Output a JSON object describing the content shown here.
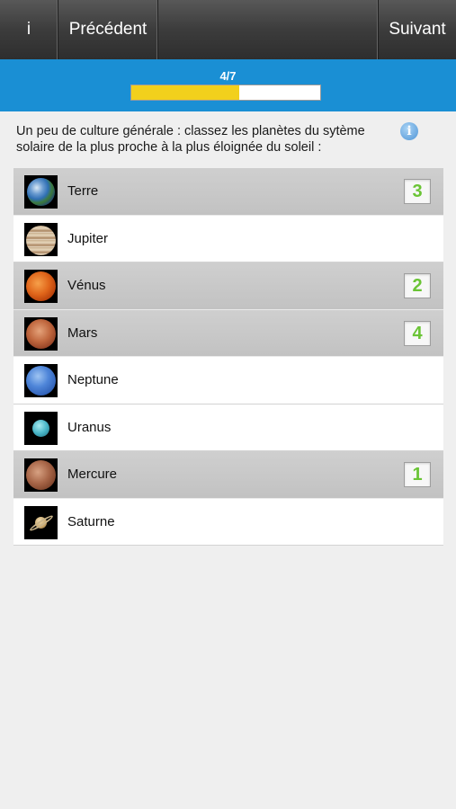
{
  "toolbar": {
    "info_label": "i",
    "prev_label": "Précédent",
    "next_label": "Suivant"
  },
  "progress": {
    "text": "4/7",
    "fraction": 0.57
  },
  "question": {
    "text": "Un peu de culture générale : classez les planètes du sytème solaire de la plus proche à la plus éloignée du soleil :"
  },
  "planets": [
    {
      "name": "Terre",
      "rank": "3",
      "selected": true,
      "icon": "earth-icon"
    },
    {
      "name": "Jupiter",
      "rank": "",
      "selected": false,
      "icon": "jupiter-icon"
    },
    {
      "name": "Vénus",
      "rank": "2",
      "selected": true,
      "icon": "venus-icon"
    },
    {
      "name": "Mars",
      "rank": "4",
      "selected": true,
      "icon": "mars-icon"
    },
    {
      "name": "Neptune",
      "rank": "",
      "selected": false,
      "icon": "neptune-icon"
    },
    {
      "name": "Uranus",
      "rank": "",
      "selected": false,
      "icon": "uranus-icon"
    },
    {
      "name": "Mercure",
      "rank": "1",
      "selected": true,
      "icon": "mercury-icon"
    },
    {
      "name": "Saturne",
      "rank": "",
      "selected": false,
      "icon": "saturn-icon"
    }
  ],
  "colors": {
    "header_blue": "#1a8fd4",
    "progress_yellow": "#f2d01c",
    "rank_green": "#6ac435"
  }
}
